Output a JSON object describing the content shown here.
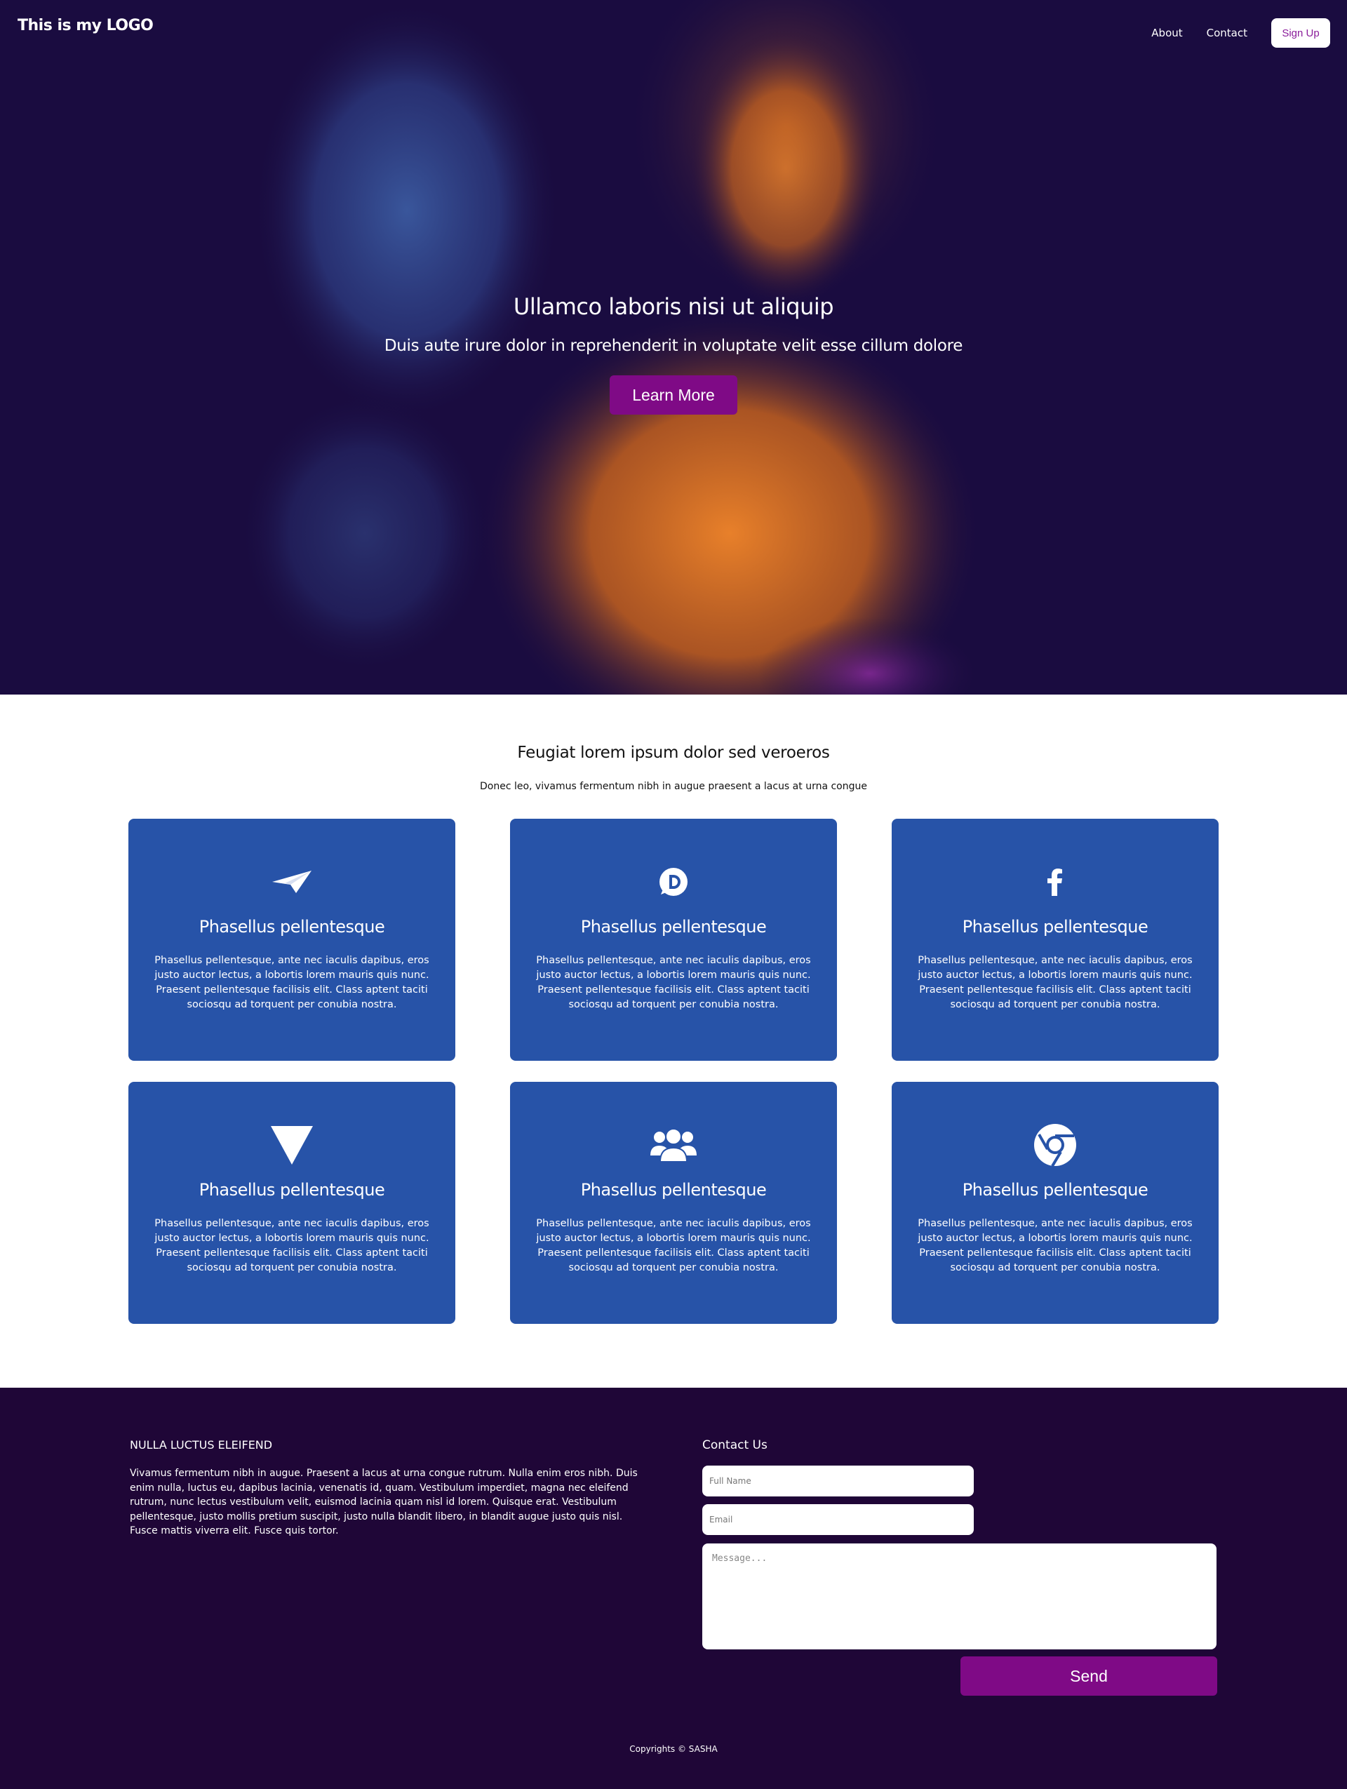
{
  "nav": {
    "logo": "This is my LOGO",
    "about": "About",
    "contact": "Contact",
    "signup": "Sign Up"
  },
  "hero": {
    "title": "Ullamco laboris nisi ut aliquip",
    "subtitle": "Duis aute irure dolor in reprehenderit in voluptate velit esse cillum dolore",
    "button": "Learn More"
  },
  "features": {
    "title": "Feugiat lorem ipsum dolor sed veroeros",
    "subtitle": "Donec leo, vivamus fermentum nibh in augue praesent a lacus at urna congue",
    "cards": [
      {
        "icon": "paper-plane-icon",
        "title": "Phasellus pellentesque",
        "text": "Phasellus pellentesque, ante nec iaculis dapibus, eros justo auctor lectus, a lobortis lorem mauris quis nunc. Praesent pellentesque facilisis elit. Class aptent taciti sociosqu ad torquent per conubia nostra."
      },
      {
        "icon": "disqus-icon",
        "title": "Phasellus pellentesque",
        "text": "Phasellus pellentesque, ante nec iaculis dapibus, eros justo auctor lectus, a lobortis lorem mauris quis nunc. Praesent pellentesque facilisis elit. Class aptent taciti sociosqu ad torquent per conubia nostra."
      },
      {
        "icon": "facebook-icon",
        "title": "Phasellus pellentesque",
        "text": "Phasellus pellentesque, ante nec iaculis dapibus, eros justo auctor lectus, a lobortis lorem mauris quis nunc. Praesent pellentesque facilisis elit. Class aptent taciti sociosqu ad torquent per conubia nostra."
      },
      {
        "icon": "triangle-down-icon",
        "title": "Phasellus pellentesque",
        "text": "Phasellus pellentesque, ante nec iaculis dapibus, eros justo auctor lectus, a lobortis lorem mauris quis nunc. Praesent pellentesque facilisis elit. Class aptent taciti sociosqu ad torquent per conubia nostra."
      },
      {
        "icon": "users-icon",
        "title": "Phasellus pellentesque",
        "text": "Phasellus pellentesque, ante nec iaculis dapibus, eros justo auctor lectus, a lobortis lorem mauris quis nunc. Praesent pellentesque facilisis elit. Class aptent taciti sociosqu ad torquent per conubia nostra."
      },
      {
        "icon": "chrome-icon",
        "title": "Phasellus pellentesque",
        "text": "Phasellus pellentesque, ante nec iaculis dapibus, eros justo auctor lectus, a lobortis lorem mauris quis nunc. Praesent pellentesque facilisis elit. Class aptent taciti sociosqu ad torquent per conubia nostra."
      }
    ]
  },
  "footer": {
    "heading": "NULLA LUCTUS ELEIFEND",
    "paragraph": "Vivamus fermentum nibh in augue. Praesent a lacus at urna congue rutrum. Nulla enim eros nibh. Duis enim nulla, luctus eu, dapibus lacinia, venenatis id, quam. Vestibulum imperdiet, magna nec eleifend rutrum, nunc lectus vestibulum velit, euismod lacinia quam nisl id lorem. Quisque erat. Vestibulum pellentesque, justo mollis pretium suscipit, justo nulla blandit libero, in blandit augue justo quis nisl. Fusce mattis viverra elit. Fusce quis tortor.",
    "contact_heading": "Contact Us",
    "name_placeholder": "Full Name",
    "email_placeholder": "Email",
    "message_placeholder": "Message...",
    "send": "Send",
    "copyright": "Copyrights © SASHA"
  },
  "colors": {
    "hero_bg": "#1a0c40",
    "accent_purple": "#7f0a86",
    "card_blue": "#2753a8",
    "footer_bg": "#1f0637"
  }
}
